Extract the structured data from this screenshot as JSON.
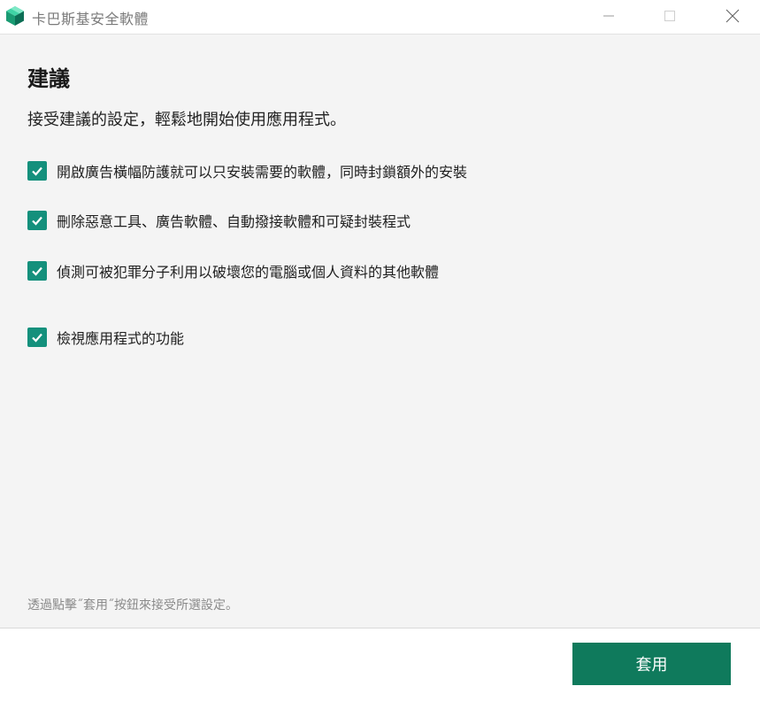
{
  "window": {
    "title": "卡巴斯基安全軟體",
    "icon": "kaspersky-cube-icon",
    "controls": [
      "minimize-icon",
      "maximize-icon",
      "close-icon"
    ]
  },
  "main": {
    "heading": "建議",
    "subtitle": "接受建議的設定，輕鬆地開始使用應用程式。",
    "options": [
      {
        "label": "開啟廣告橫幅防護就可以只安裝需要的軟體，同時封鎖額外的安裝",
        "checked": true
      },
      {
        "label": "刪除惡意工具、廣告軟體、自動撥接軟體和可疑封裝程式",
        "checked": true
      },
      {
        "label": "偵測可被犯罪分子利用以破壞您的電腦或個人資料的其他軟體",
        "checked": true
      },
      {
        "label": "檢視應用程式的功能",
        "checked": true
      }
    ],
    "footnote": "透過點擊˝套用˝按鈕來接受所選設定。"
  },
  "footer": {
    "apply_label": "套用"
  },
  "colors": {
    "checkbox": "#14907c",
    "button": "#0f7a5c",
    "background": "#f4f4f4"
  }
}
